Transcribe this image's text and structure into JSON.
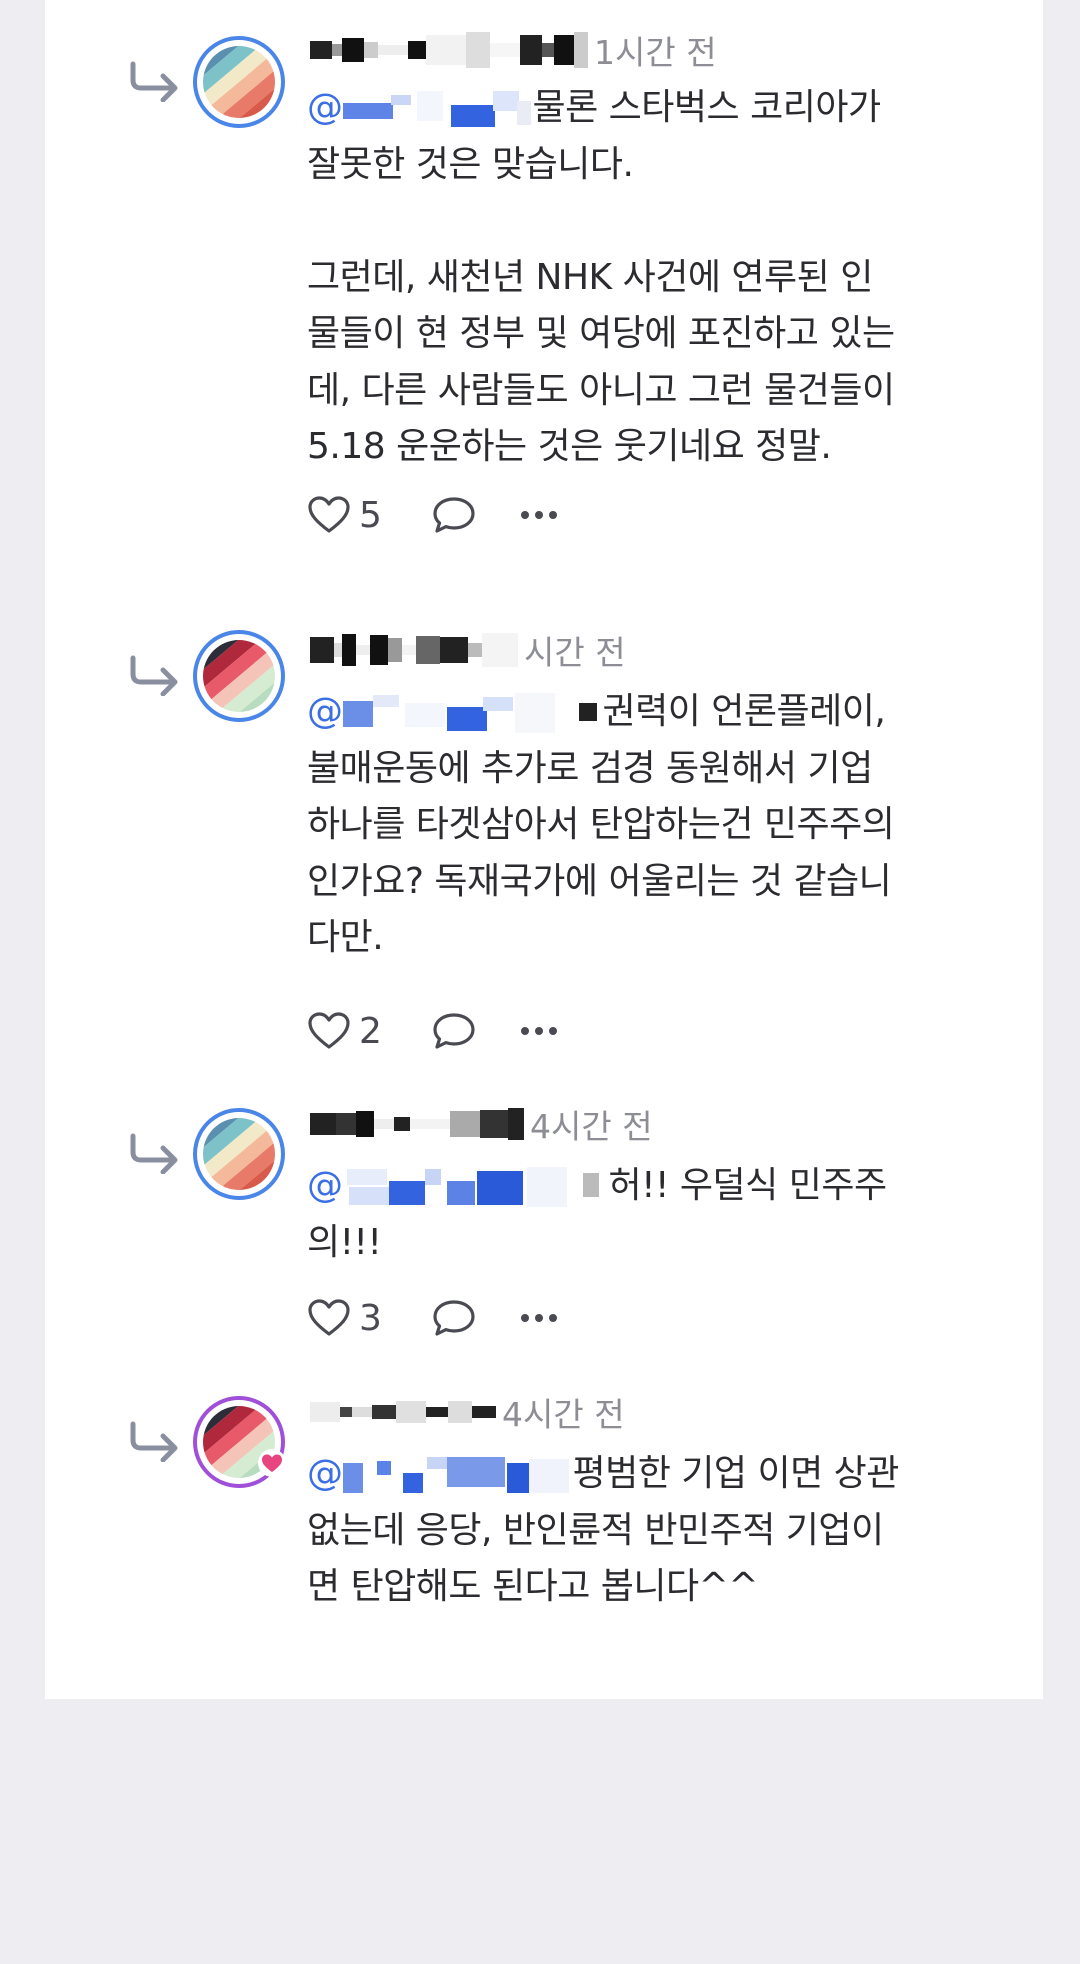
{
  "comments": [
    {
      "author_name": "",
      "time": "1시간 전",
      "mention": "@",
      "text_first": "물론 스타벅스 코리아가",
      "text_rest": "잘못한 것은 맞습니다.\n\n그런데, 새천년 NHK 사건에 연루된 인\n물들이 현 정부 및 여당에 포진하고 있는\n데, 다른 사람들도 아니고 그런 물건들이\n5.18 운운하는 것은 웃기네요 정말.",
      "likes": "5",
      "avatar_style": "pastel",
      "has_actions": true
    },
    {
      "author_name": "",
      "time": "시간 전",
      "mention": "@",
      "text_first": "권력이 언론플레이,",
      "text_rest": "불매운동에 추가로 검경 동원해서 기업\n하나를 타겟삼아서 탄압하는건 민주주의\n인가요? 독재국가에 어울리는 것 같습니\n다만.",
      "likes": "2",
      "avatar_style": "dark",
      "has_actions": true
    },
    {
      "author_name": "",
      "time": "4시간 전",
      "mention": "@",
      "text_first": "허!! 우덜식 민주주",
      "text_rest": "의!!!",
      "likes": "3",
      "avatar_style": "pastel",
      "has_actions": true
    },
    {
      "author_name": "",
      "time": "4시간 전",
      "mention": "@",
      "text_first": "평범한 기업 이면 상관",
      "text_rest": "없는데 응당, 반인륜적 반민주적 기업이\n면 탄압해도 된다고 봅니다^^",
      "likes": "",
      "avatar_style": "dark-heart",
      "has_actions": false
    }
  ],
  "icons": {
    "reply_indicator": "reply-arrow-icon",
    "like": "heart-outline-icon",
    "comment": "speech-bubble-icon",
    "more": "more-dots-icon",
    "badge": "heart-badge-icon"
  },
  "colors": {
    "mention": "#3b6fe3",
    "avatar_ring_blue": "#4a86e8",
    "avatar_ring_purple": "#a04fd8",
    "time": "#8d8d95",
    "badge_pink": "#e8457f"
  }
}
